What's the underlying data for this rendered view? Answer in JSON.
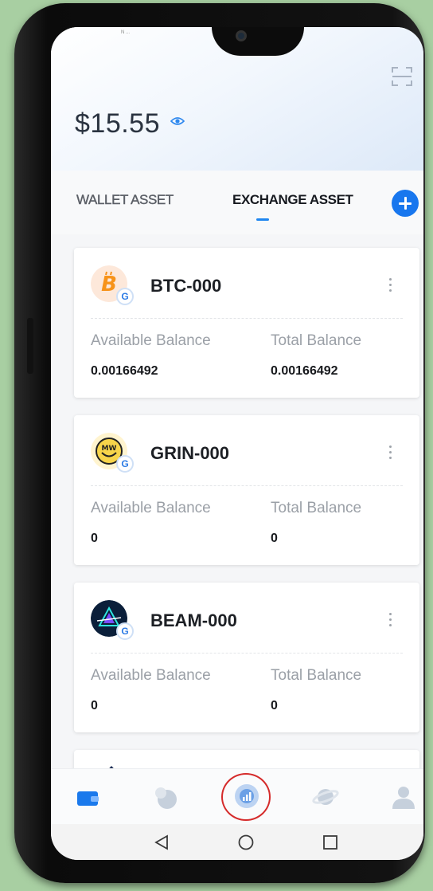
{
  "status_bar": {
    "text": "N ..."
  },
  "header": {
    "balance": "$15.55",
    "icons": {
      "scan": "scan-icon",
      "eye": "eye-icon"
    }
  },
  "tabs": {
    "wallet_label": "WALLET ASSET",
    "exchange_label": "EXCHANGE ASSET",
    "active": "exchange",
    "add_icon": "plus-circle-icon"
  },
  "cards": [
    {
      "name": "BTC-000",
      "available_label": "Available Balance",
      "total_label": "Total Balance",
      "available": "0.00166492",
      "total": "0.00166492",
      "badge": "G"
    },
    {
      "name": "GRIN-000",
      "available_label": "Available Balance",
      "total_label": "Total Balance",
      "available": "0",
      "total": "0",
      "badge": "G"
    },
    {
      "name": "BEAM-000",
      "available_label": "Available Balance",
      "total_label": "Total Balance",
      "available": "0",
      "total": "0",
      "badge": "G"
    }
  ],
  "bottom_nav": [
    {
      "icon": "wallet-icon",
      "active": true
    },
    {
      "icon": "orbit-icon",
      "active": false
    },
    {
      "icon": "exchange-chart-icon",
      "active": false,
      "highlighted": true
    },
    {
      "icon": "planet-icon",
      "active": false
    },
    {
      "icon": "profile-icon",
      "active": false
    }
  ],
  "system_nav": [
    "back-icon",
    "home-icon",
    "recents-icon"
  ],
  "colors": {
    "accent": "#1f86f0",
    "highlight_circle": "#d52b2b"
  }
}
